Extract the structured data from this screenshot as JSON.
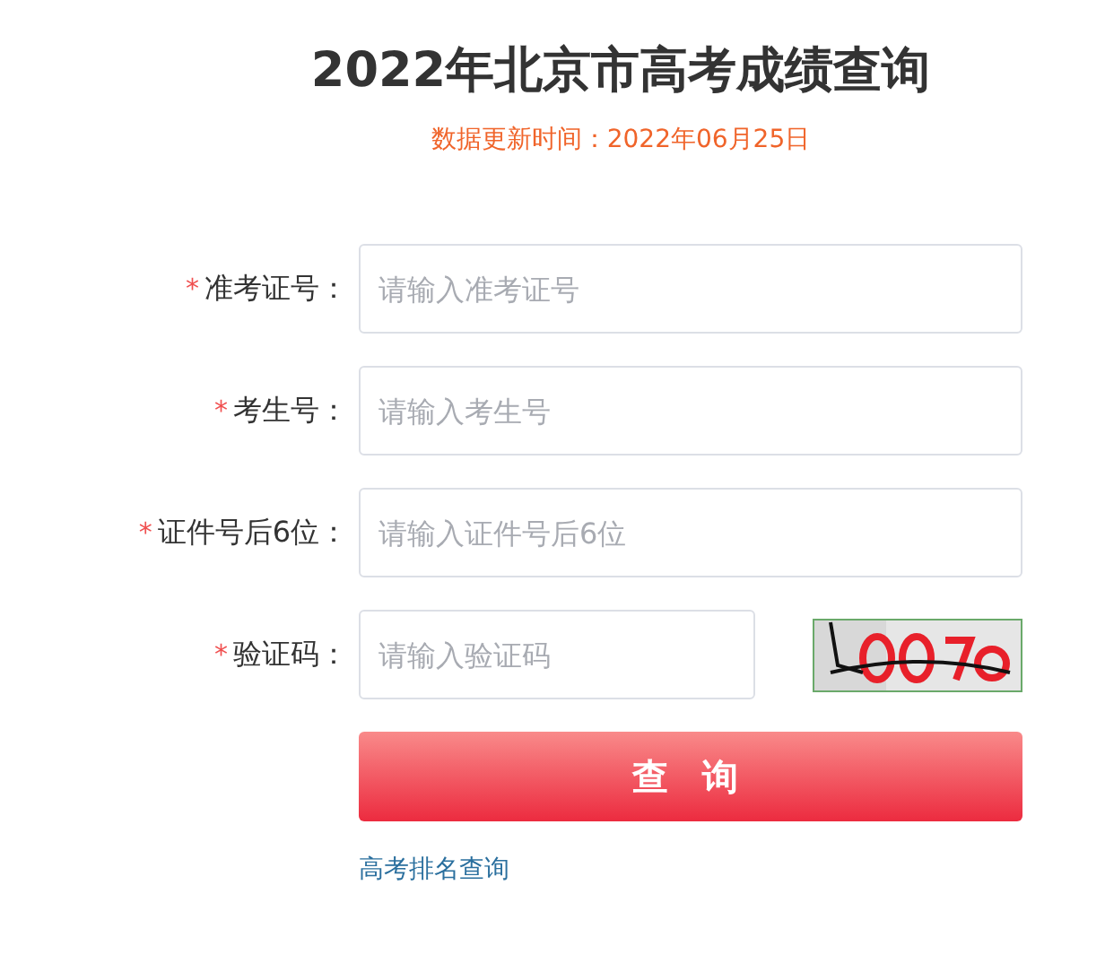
{
  "title": "2022年北京市高考成绩查询",
  "updated": "数据更新时间：2022年06月25日",
  "fields": [
    {
      "kind": "text",
      "required_mark": "*",
      "label": "准考证号：",
      "placeholder": "请输入准考证号"
    },
    {
      "kind": "text",
      "required_mark": "*",
      "label": "考生号：",
      "placeholder": "请输入考生号"
    },
    {
      "kind": "text",
      "required_mark": "*",
      "label": "证件号后6位：",
      "placeholder": "请输入证件号后6位"
    },
    {
      "kind": "captcha",
      "required_mark": "*",
      "label": "验证码：",
      "placeholder": "请输入验证码"
    }
  ],
  "submit": "查 询",
  "link": "高考排名查询"
}
